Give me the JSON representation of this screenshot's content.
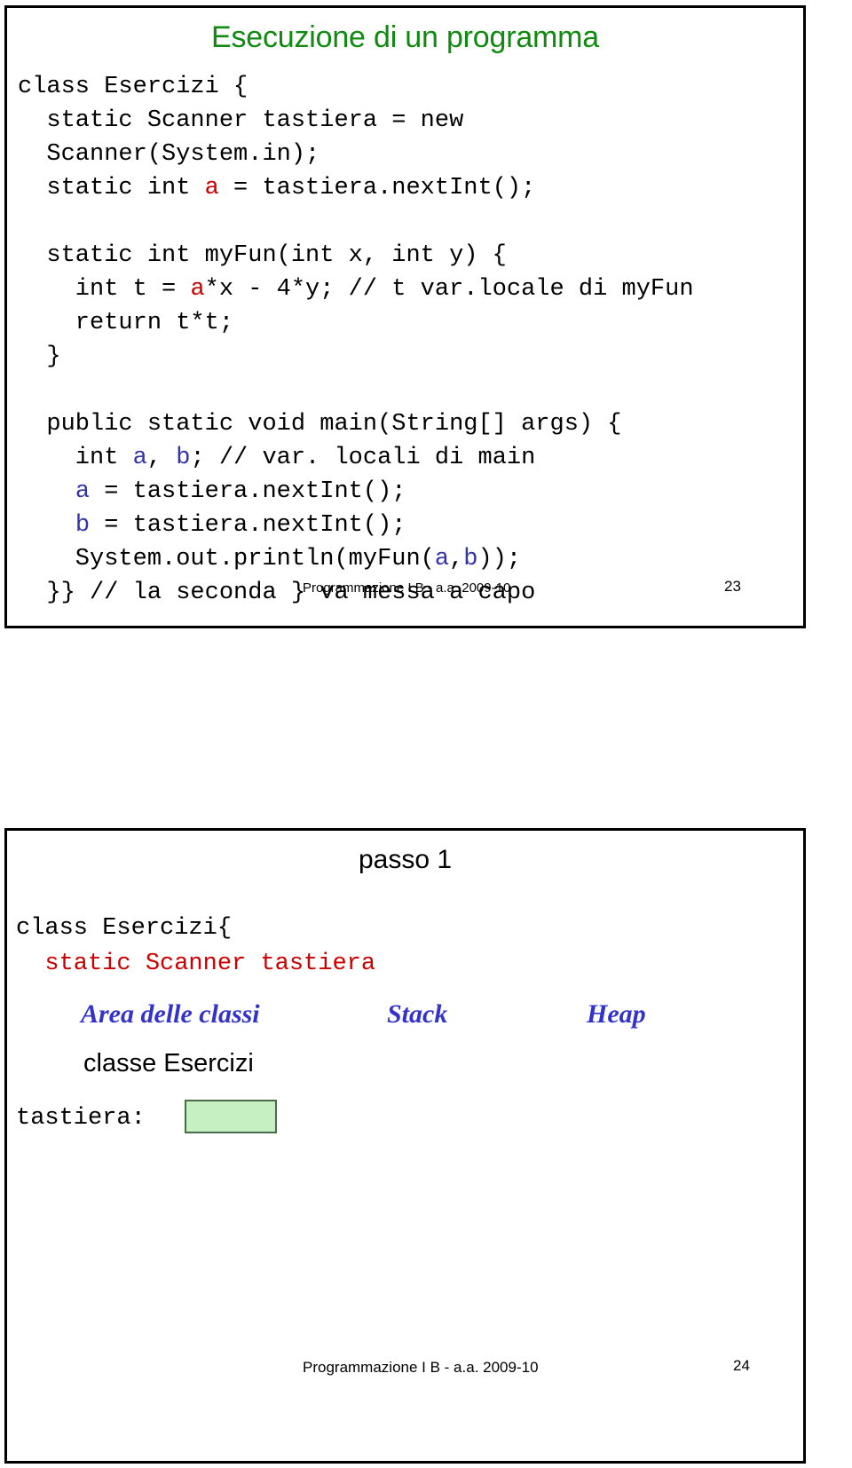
{
  "slide1": {
    "title": "Esecuzione di un programma",
    "code_lines": [
      [
        {
          "t": "class Esercizi {",
          "c": "plain"
        }
      ],
      [
        {
          "t": "  static Scanner tastiera = new",
          "c": "plain"
        }
      ],
      [
        {
          "t": "  Scanner(System.in);",
          "c": "plain"
        }
      ],
      [
        {
          "t": "  static int ",
          "c": "plain"
        },
        {
          "t": "a",
          "c": "red"
        },
        {
          "t": " = tastiera.nextInt();",
          "c": "plain"
        }
      ],
      [
        {
          "t": "",
          "c": "plain"
        }
      ],
      [
        {
          "t": "  static int myFun(int x, int y) {",
          "c": "plain"
        }
      ],
      [
        {
          "t": "    int t = ",
          "c": "plain"
        },
        {
          "t": "a",
          "c": "red"
        },
        {
          "t": "*x - 4*y; // t var.locale di myFun",
          "c": "plain"
        }
      ],
      [
        {
          "t": "    return t*t;",
          "c": "plain"
        }
      ],
      [
        {
          "t": "  }",
          "c": "plain"
        }
      ],
      [
        {
          "t": "",
          "c": "plain"
        }
      ],
      [
        {
          "t": "  public static void main(String[] args) {",
          "c": "plain"
        }
      ],
      [
        {
          "t": "    int ",
          "c": "plain"
        },
        {
          "t": "a",
          "c": "blue"
        },
        {
          "t": ", ",
          "c": "plain"
        },
        {
          "t": "b",
          "c": "blue"
        },
        {
          "t": "; // var. locali di main",
          "c": "plain"
        }
      ],
      [
        {
          "t": "    ",
          "c": "plain"
        },
        {
          "t": "a",
          "c": "blue"
        },
        {
          "t": " = tastiera.nextInt();",
          "c": "plain"
        }
      ],
      [
        {
          "t": "    ",
          "c": "plain"
        },
        {
          "t": "b",
          "c": "blue"
        },
        {
          "t": " = tastiera.nextInt();",
          "c": "plain"
        }
      ],
      [
        {
          "t": "    System.out.println(myFun(",
          "c": "plain"
        },
        {
          "t": "a",
          "c": "blue"
        },
        {
          "t": ",",
          "c": "plain"
        },
        {
          "t": "b",
          "c": "blue"
        },
        {
          "t": "));",
          "c": "plain"
        }
      ],
      [
        {
          "t": "  }} // la seconda } va messa a capo",
          "c": "plain"
        }
      ]
    ],
    "footer": "Programmazione I B - a.a. 2009-10",
    "page_number": "23"
  },
  "slide2": {
    "step_label": "passo 1",
    "code_lines": [
      [
        {
          "t": "class Esercizi{",
          "c": "plain"
        }
      ],
      [
        {
          "t": "  static Scanner tastiera",
          "c": "red"
        }
      ]
    ],
    "memory_areas": [
      {
        "name": "Area delle classi"
      },
      {
        "name": "Stack"
      },
      {
        "name": "Heap"
      }
    ],
    "class_area_entry": "classe Esercizi",
    "variable_label": "tastiera:",
    "variable_slot_value": "",
    "footer": "Programmazione I B - a.a. 2009-10",
    "page_number": "24"
  },
  "colors": {
    "title_green": "#108A10",
    "code_red": "#CC0000",
    "code_blue": "#3333AA",
    "memory_header_blue": "#3333CC",
    "slot_fill": "#C6F0C2",
    "slot_border": "#4A6B4A"
  }
}
